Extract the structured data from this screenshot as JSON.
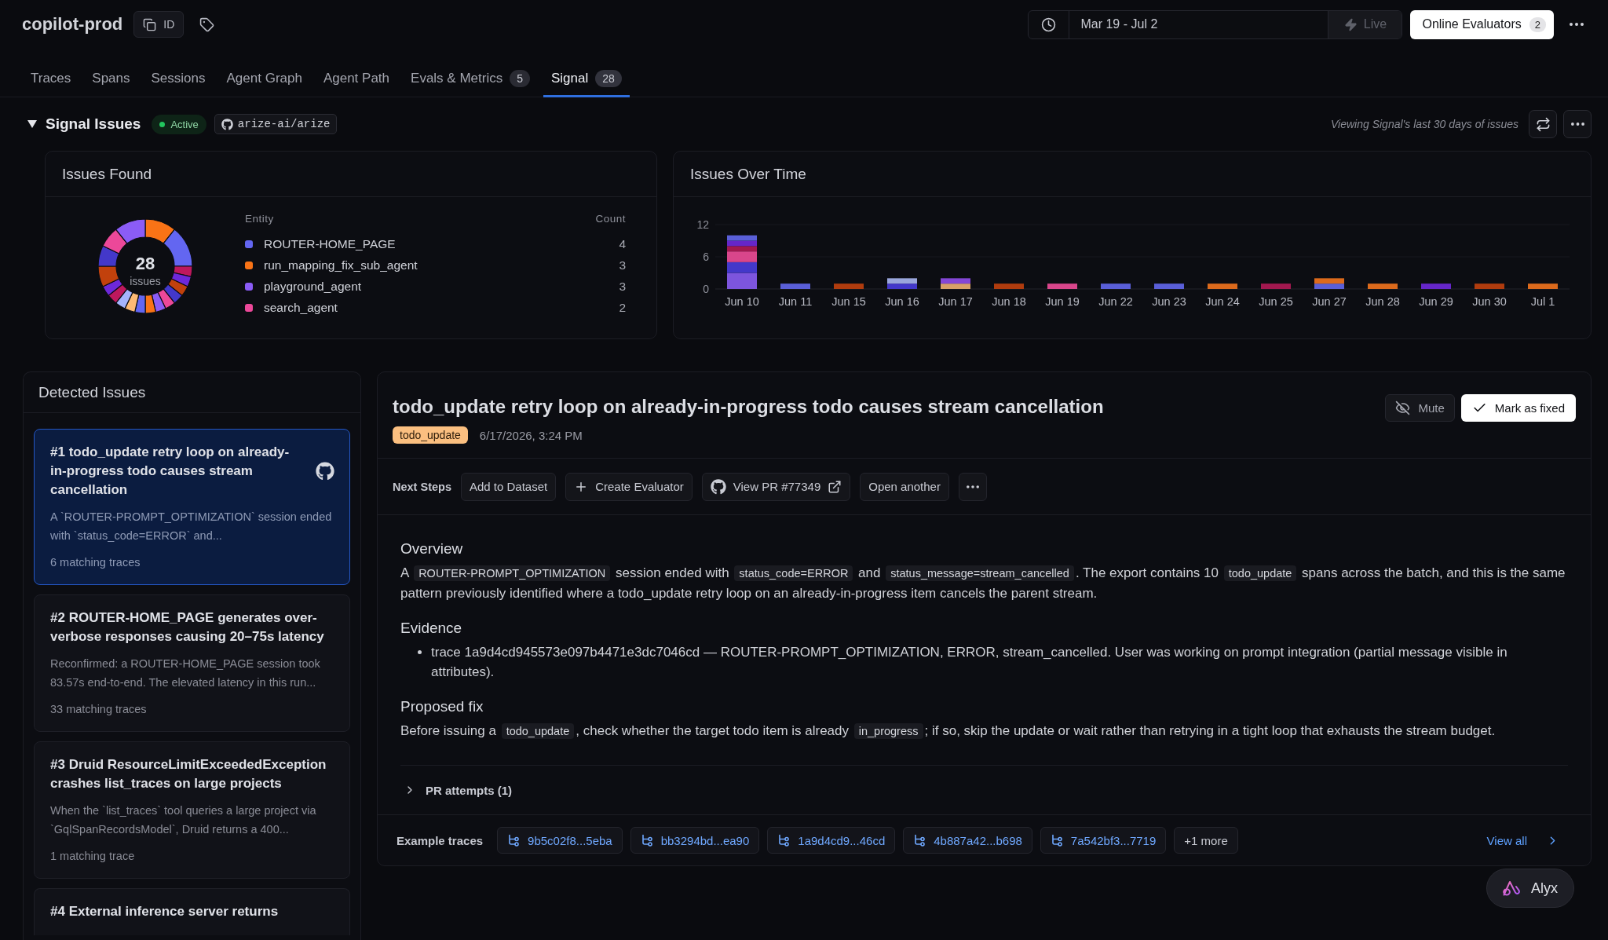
{
  "header": {
    "project": "copilot-prod",
    "id_button": "ID",
    "date_range": "Mar 19 - Jul 2",
    "live": {
      "label": "Live",
      "on": false
    },
    "evaluators_button": {
      "label": "Online Evaluators",
      "count": "2"
    }
  },
  "tabs": [
    {
      "label": "Traces",
      "selected": false
    },
    {
      "label": "Spans",
      "selected": false
    },
    {
      "label": "Sessions",
      "selected": false
    },
    {
      "label": "Agent Graph",
      "selected": false
    },
    {
      "label": "Agent Path",
      "selected": false
    },
    {
      "label": "Evals & Metrics",
      "count": "5",
      "selected": false
    },
    {
      "label": "Signal",
      "count": "28",
      "selected": true
    }
  ],
  "signal": {
    "title": "Signal Issues",
    "expanded": true,
    "status": "Active",
    "repo": "arize-ai/arize",
    "note": "Viewing Signal's last 30 days of issues",
    "issues_found": {
      "title": "Issues Found",
      "total": "28",
      "total_label": "issues",
      "chart_data": {
        "type": "donut",
        "values": [
          10.71,
          14.29,
          3.57,
          3.57,
          3.57,
          3.57,
          3.57,
          3.57,
          3.57,
          3.57,
          3.57,
          3.58,
          3.58,
          3.58,
          7.14,
          7.14,
          7.14,
          10.71
        ],
        "colors": [
          "#f97316",
          "#6366f1",
          "#be185d",
          "#6d28d9",
          "#c2410c",
          "#4338ca",
          "#ec4899",
          "#8b5cf6",
          "#f97316",
          "#6366f1",
          "#fdba74",
          "#a5b4fc",
          "#be185d",
          "#6d28d9",
          "#c2410c",
          "#4338ca",
          "#ec4899",
          "#8b5cf6"
        ]
      },
      "columns": [
        "Entity",
        "Count"
      ],
      "entities": [
        {
          "name": "ROUTER-HOME_PAGE",
          "count": "4",
          "color": "#6366f1"
        },
        {
          "name": "run_mapping_fix_sub_agent",
          "count": "3",
          "color": "#f97316"
        },
        {
          "name": "playground_agent",
          "count": "3",
          "color": "#8b5cf6"
        },
        {
          "name": "search_agent",
          "count": "2",
          "color": "#ec4899"
        }
      ]
    },
    "issues_over_time": {
      "title": "Issues Over Time",
      "chart_data": {
        "type": "bar",
        "stacked": true,
        "categories": [
          "Jun 10",
          "Jun 11",
          "Jun 15",
          "Jun 16",
          "Jun 17",
          "Jun 18",
          "Jun 19",
          "Jun 22",
          "Jun 23",
          "Jun 24",
          "Jun 25",
          "Jun 27",
          "Jun 28",
          "Jun 29",
          "Jun 30",
          "Jul 1"
        ],
        "ylim": [
          0,
          12
        ],
        "yticks": [
          0,
          6,
          12
        ],
        "series": [
          {
            "color": "#7d55dd",
            "values": [
              3,
              0,
              0,
              0,
              0,
              0,
              0,
              0,
              0,
              0,
              0,
              0,
              0,
              0,
              0,
              0
            ]
          },
          {
            "color": "#4338ca",
            "values": [
              2,
              0,
              0,
              1,
              0,
              0,
              0,
              0,
              0,
              0,
              0,
              0,
              0,
              0,
              0,
              0
            ]
          },
          {
            "color": "#d9468b",
            "values": [
              2,
              0,
              0,
              0,
              0,
              0,
              1,
              0,
              0,
              0,
              0,
              0,
              0,
              0,
              0,
              0
            ]
          },
          {
            "color": "#a2184f",
            "values": [
              1,
              0,
              0,
              0,
              0,
              0,
              0,
              0,
              0,
              0,
              1,
              0,
              0,
              0,
              0,
              0
            ]
          },
          {
            "color": "#6526c9",
            "values": [
              1,
              0,
              0,
              0,
              0,
              0,
              0,
              0,
              0,
              0,
              0,
              0,
              0,
              1,
              0,
              0
            ]
          },
          {
            "color": "#5a5fd8",
            "values": [
              1,
              1,
              0,
              0,
              0,
              0,
              0,
              1,
              1,
              0,
              0,
              1,
              0,
              0,
              0,
              0
            ]
          },
          {
            "color": "#b03c0e",
            "values": [
              0,
              0,
              1,
              0,
              0,
              1,
              0,
              0,
              0,
              0,
              0,
              0,
              0,
              0,
              1,
              0
            ]
          },
          {
            "color": "#9aa6dc",
            "values": [
              0,
              0,
              0,
              1,
              0,
              0,
              0,
              0,
              0,
              0,
              0,
              0,
              0,
              0,
              0,
              0
            ]
          },
          {
            "color": "#d8a068",
            "values": [
              0,
              0,
              0,
              0,
              1,
              0,
              0,
              0,
              0,
              0,
              0,
              0,
              0,
              0,
              0,
              0
            ]
          },
          {
            "color": "#8446d6",
            "values": [
              0,
              0,
              0,
              0,
              1,
              0,
              0,
              0,
              0,
              0,
              0,
              0,
              0,
              0,
              0,
              0
            ]
          },
          {
            "color": "#dc6a1c",
            "values": [
              0,
              0,
              0,
              0,
              0,
              0,
              0,
              0,
              0,
              1,
              0,
              1,
              1,
              0,
              0,
              1
            ]
          }
        ]
      }
    }
  },
  "detected_issues": {
    "title": "Detected Issues",
    "items": [
      {
        "title": "#1 todo_update retry loop on already-in-progress todo causes stream cancellation",
        "summary": "A `ROUTER-PROMPT_OPTIMIZATION` session ended with `status_code=ERROR` and...",
        "traces": "6 matching traces",
        "selected": true,
        "pr_linked": true
      },
      {
        "title": "#2 ROUTER-HOME_PAGE generates over-verbose responses causing 20–75s latency",
        "summary": "Reconfirmed: a ROUTER-HOME_PAGE session took 83.57s end-to-end. The elevated latency in this run...",
        "traces": "33 matching traces",
        "selected": false,
        "pr_linked": false
      },
      {
        "title": "#3 Druid ResourceLimitExceededException crashes list_traces on large projects",
        "summary": "When the `list_traces` tool queries a large project via `GqlSpanRecordsModel`, Druid returns a 400...",
        "traces": "1 matching trace",
        "selected": false,
        "pr_linked": false
      },
      {
        "title": "#4 External inference server returns",
        "selected": false,
        "pr_linked": false
      }
    ]
  },
  "detail": {
    "title": "todo_update retry loop on already-in-progress todo causes stream cancellation",
    "tag": "todo_update",
    "timestamp": "6/17/2026, 3:24 PM",
    "mute_button": "Mute",
    "fix_button": "Mark as fixed",
    "next_steps": {
      "label": "Next Steps",
      "actions": [
        {
          "kind": "plain",
          "label": "Add to Dataset"
        },
        {
          "kind": "create",
          "label": "Create Evaluator"
        },
        {
          "kind": "pr",
          "label": "View PR #77349"
        },
        {
          "kind": "plain",
          "label": "Open another"
        },
        {
          "kind": "more"
        }
      ]
    },
    "sections": [
      {
        "heading": "Overview",
        "kind": "paragraph",
        "segments": [
          {
            "kind": "text",
            "text": "A "
          },
          {
            "kind": "code",
            "text": "ROUTER-PROMPT_OPTIMIZATION"
          },
          {
            "kind": "text",
            "text": " session ended with "
          },
          {
            "kind": "code",
            "text": "status_code=ERROR"
          },
          {
            "kind": "text",
            "text": " and "
          },
          {
            "kind": "code",
            "text": "status_message=stream_cancelled"
          },
          {
            "kind": "text",
            "text": ". The export contains 10 "
          },
          {
            "kind": "code",
            "text": "todo_update"
          },
          {
            "kind": "text",
            "text": " spans across the batch, and this is the same pattern previously identified where a todo_update retry loop on an already-in-progress item cancels the parent stream."
          }
        ]
      },
      {
        "heading": "Evidence",
        "kind": "bullets",
        "items": [
          {
            "segments": [
              {
                "kind": "text",
                "text": "trace 1a9d4cd945573e097b4471e3dc7046cd — ROUTER-PROMPT_OPTIMIZATION, ERROR, stream_cancelled. User was working on prompt integration (partial message visible in attributes)."
              }
            ]
          }
        ]
      },
      {
        "heading": "Proposed fix",
        "kind": "paragraph",
        "segments": [
          {
            "kind": "text",
            "text": "Before issuing a "
          },
          {
            "kind": "code",
            "text": "todo_update"
          },
          {
            "kind": "text",
            "text": ", check whether the target todo item is already "
          },
          {
            "kind": "code",
            "text": "in_progress"
          },
          {
            "kind": "text",
            "text": "; if so, skip the update or wait rather than retrying in a tight loop that exhausts the stream budget."
          }
        ]
      }
    ],
    "pr_attempts": {
      "label": "PR attempts (1)",
      "expanded": false
    },
    "example_traces": {
      "label": "Example traces",
      "traces": [
        "9b5c02f8...5eba",
        "bb3294bd...ea90",
        "1a9d4cd9...46cd",
        "4b887a42...b698",
        "7a542bf3...7719"
      ],
      "more": "+1 more",
      "view_all": "View all"
    }
  },
  "assistant_button": "Alyx"
}
